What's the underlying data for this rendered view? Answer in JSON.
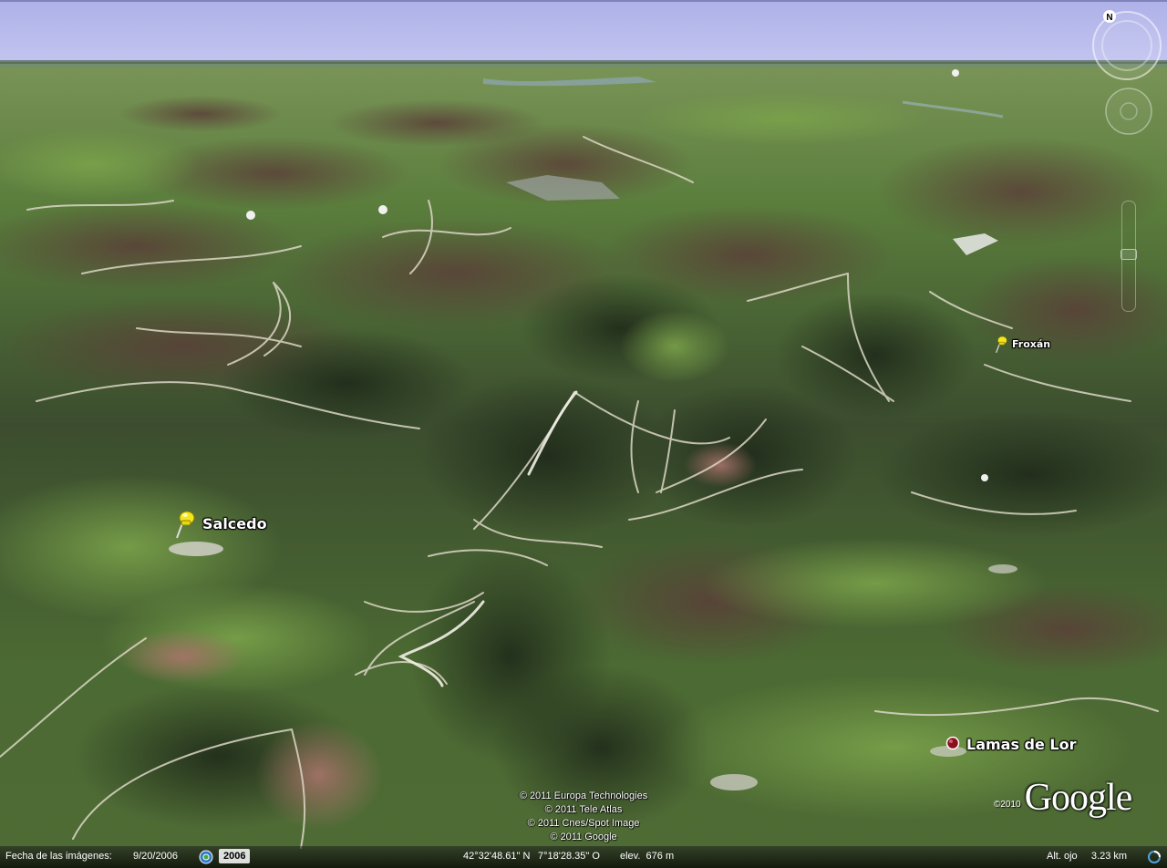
{
  "colors": {
    "sky": "#b6b9ec",
    "terrain_green": "#4b7a34",
    "terrain_dark": "#2f3b26",
    "terrain_brown": "#5c4236",
    "pin_yellow": "#f3e61c",
    "dot_marker": "#8a0f1f"
  },
  "placemarks": [
    {
      "name": "Salcedo",
      "icon": "yellow-pushpin-icon"
    },
    {
      "name": "Froxán",
      "icon": "yellow-pushpin-icon"
    },
    {
      "name": "Lamas de Lor",
      "icon": "red-dot-icon"
    }
  ],
  "navigation": {
    "compass_north": "N",
    "compass_icon": "compass-icon",
    "look_icon": "look-joystick-icon",
    "zoom_icon": "zoom-slider"
  },
  "copyright": [
    "© 2011 Europa Technologies",
    "© 2011 Tele Atlas",
    "© 2011 Cnes/Spot Image",
    "© 2011 Google"
  ],
  "logo": {
    "year": "©2010",
    "word": "Google"
  },
  "status_bar": {
    "imagery_date_label": "Fecha de las imágenes:",
    "imagery_date": "9/20/2006",
    "history_icon": "historical-imagery-icon",
    "history_year": "2006",
    "latitude": "42°32'48.61\" N",
    "longitude": "7°18'28.35\" O",
    "elevation": "elev.  676 m",
    "eye_altitude": "Alt. ojo     3.23 km",
    "streaming_icon": "streaming-indicator-icon"
  }
}
